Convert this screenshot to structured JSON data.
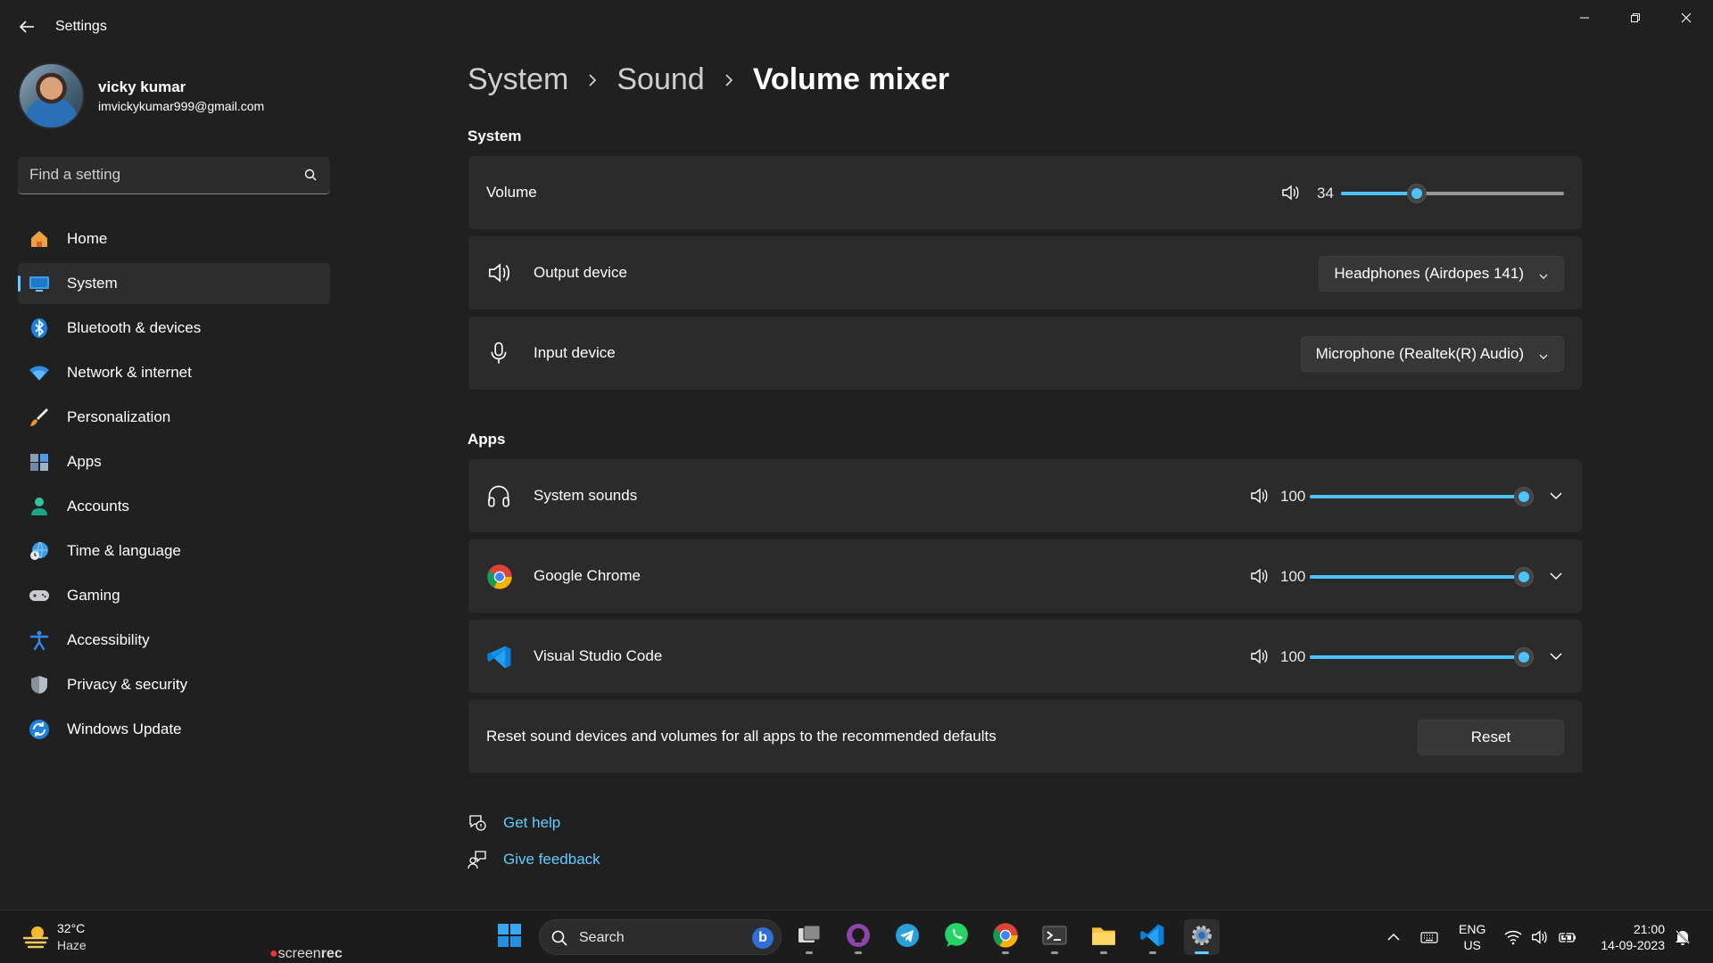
{
  "window": {
    "title": "Settings"
  },
  "user": {
    "name": "vicky kumar",
    "email": "imvickykumar999@gmail.com"
  },
  "search": {
    "placeholder": "Find a setting"
  },
  "nav": [
    {
      "label": "Home",
      "icon": "home-icon"
    },
    {
      "label": "System",
      "icon": "system-icon",
      "active": true
    },
    {
      "label": "Bluetooth & devices",
      "icon": "bluetooth-icon"
    },
    {
      "label": "Network & internet",
      "icon": "wifi-icon"
    },
    {
      "label": "Personalization",
      "icon": "brush-icon"
    },
    {
      "label": "Apps",
      "icon": "apps-icon"
    },
    {
      "label": "Accounts",
      "icon": "accounts-icon"
    },
    {
      "label": "Time & language",
      "icon": "globe-clock-icon"
    },
    {
      "label": "Gaming",
      "icon": "gamepad-icon"
    },
    {
      "label": "Accessibility",
      "icon": "accessibility-icon"
    },
    {
      "label": "Privacy & security",
      "icon": "shield-icon"
    },
    {
      "label": "Windows Update",
      "icon": "update-icon"
    }
  ],
  "breadcrumb": [
    "System",
    "Sound",
    "Volume mixer"
  ],
  "system_section": {
    "label": "System",
    "volume": {
      "label": "Volume",
      "value": "34",
      "level": 34
    },
    "output": {
      "label": "Output device",
      "selected": "Headphones (Airdopes 141)"
    },
    "input": {
      "label": "Input device",
      "selected": "Microphone (Realtek(R) Audio)"
    }
  },
  "apps_section": {
    "label": "Apps",
    "apps": [
      {
        "name": "System sounds",
        "icon": "headphones-icon",
        "value": "100",
        "level": 100
      },
      {
        "name": "Google Chrome",
        "icon": "chrome-icon",
        "value": "100",
        "level": 100
      },
      {
        "name": "Visual Studio Code",
        "icon": "vscode-icon",
        "value": "100",
        "level": 100
      }
    ],
    "reset": {
      "text": "Reset sound devices and volumes for all apps to the recommended defaults",
      "button": "Reset"
    }
  },
  "links": {
    "help": "Get help",
    "feedback": "Give feedback"
  },
  "taskbar": {
    "weather": {
      "temp": "32°C",
      "desc": "Haze"
    },
    "watermark": {
      "dot": "●",
      "prefix": "screen",
      "suffix": "rec"
    },
    "search_label": "Search",
    "bing_letter": "b",
    "lang": {
      "line1": "ENG",
      "line2": "US"
    },
    "clock": {
      "time": "21:00",
      "date": "14-09-2023"
    }
  },
  "colors": {
    "accent": "#60cdff",
    "slider_fill": "#4cc2ff",
    "background": "#202020",
    "card": "#2b2b2b"
  }
}
